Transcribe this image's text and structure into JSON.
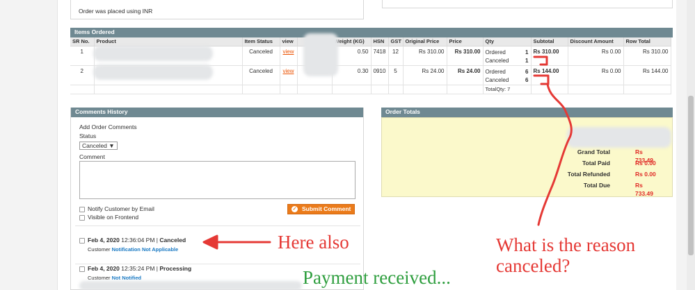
{
  "top": {
    "order_note": "Order was placed using INR"
  },
  "items_ordered": {
    "title": "Items Ordered",
    "columns": [
      "SR No.",
      "Product",
      "Item Status",
      "view",
      "",
      "Weight (KG)",
      "HSN",
      "GST",
      "Original Price",
      "Price",
      "Qty",
      "Subtotal",
      "Discount Amount",
      "Row Total"
    ],
    "rows": [
      {
        "sr": "1",
        "status": "Canceled",
        "view": "view",
        "weight": "0.50",
        "hsn": "7418",
        "gst": "12",
        "original_price": "Rs 310.00",
        "price": "Rs 310.00",
        "qty_ordered_label": "Ordered",
        "qty_ordered": "1",
        "qty_canceled_label": "Canceled",
        "qty_canceled": "1",
        "subtotal": "Rs 310.00",
        "discount": "Rs 0.00",
        "row_total": "Rs 310.00"
      },
      {
        "sr": "2",
        "status": "Canceled",
        "view": "view",
        "weight": "0.30",
        "hsn": "0910",
        "gst": "5",
        "original_price": "Rs 24.00",
        "price": "Rs 24.00",
        "qty_ordered_label": "Ordered",
        "qty_ordered": "6",
        "qty_canceled_label": "Canceled",
        "qty_canceled": "6",
        "subtotal": "Rs 144.00",
        "discount": "Rs 0.00",
        "row_total": "Rs 144.00"
      }
    ],
    "total_qty": "TotalQty: 7"
  },
  "comments_history": {
    "title": "Comments History",
    "add_label": "Add Order Comments",
    "status_label": "Status",
    "status_value": "Canceled",
    "comment_label": "Comment",
    "notify_label": "Notify Customer by Email",
    "visible_label": "Visible on Frontend",
    "submit_label": "Submit Comment",
    "entries": [
      {
        "date": "Feb 4, 2020",
        "time": "12:36:04 PM",
        "status": "Canceled",
        "note_prefix": "Customer",
        "note_value": "Notification Not Applicable"
      },
      {
        "date": "Feb 4, 2020",
        "time": "12:35:24 PM",
        "status": "Processing",
        "note_prefix": "Customer",
        "note_value": "Not Notified"
      }
    ]
  },
  "order_totals": {
    "title": "Order Totals",
    "rows": [
      {
        "label": "Grand Total",
        "value": "Rs 733.49"
      },
      {
        "label": "Total Paid",
        "value": "Rs 0.00"
      },
      {
        "label": "Total Refunded",
        "value": "Rs 0.00"
      },
      {
        "label": "Total Due",
        "value": "Rs 733.49"
      }
    ]
  },
  "annotations": {
    "here_also": "Here also",
    "question_line1": "What is the reason",
    "question_line2": "canceled?",
    "payment": "Payment received..."
  },
  "colors": {
    "section_header": "#6f8992",
    "link_orange": "#eb5202",
    "totals_bg": "#fbf9cb",
    "totals_value_red": "#e02b27",
    "annotation_red": "#e53935",
    "annotation_green": "#2e9e3e"
  }
}
